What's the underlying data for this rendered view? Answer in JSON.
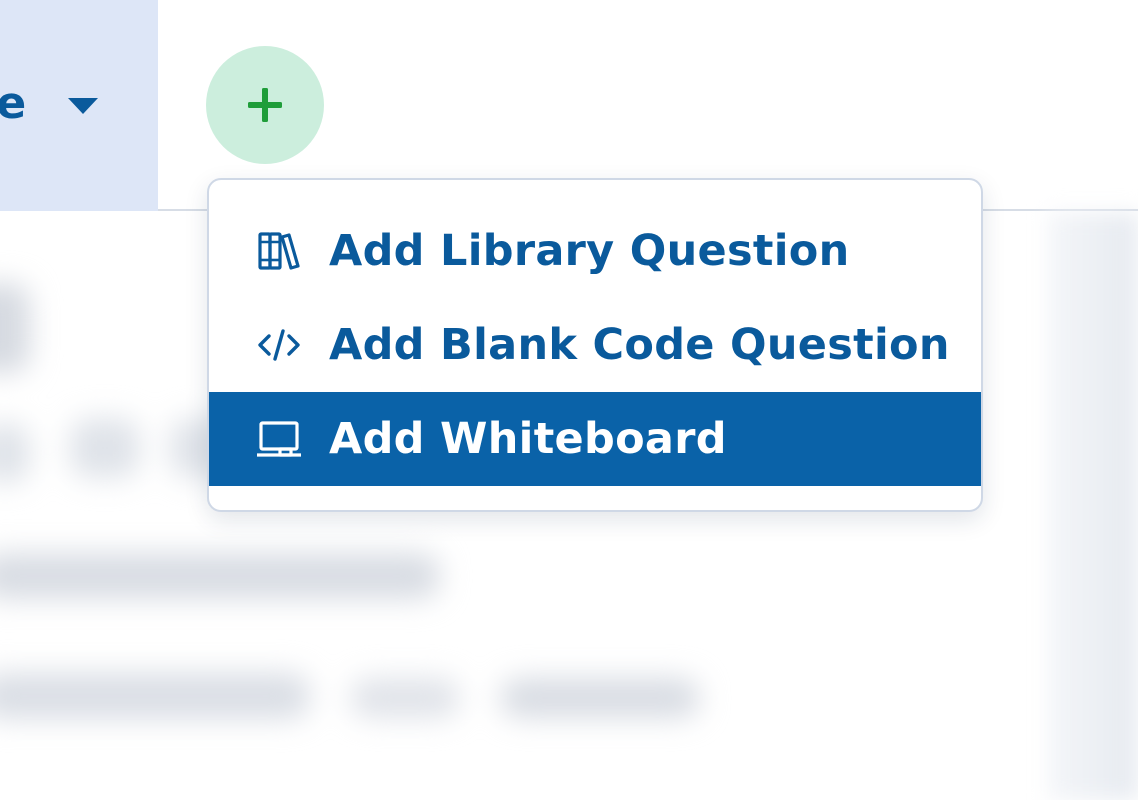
{
  "header": {
    "tab_label_partial": "ne",
    "add_button_icon": "plus-icon",
    "accent_color": "#0a5a9c",
    "add_button_color": "#1f9d3a"
  },
  "menu": {
    "items": [
      {
        "label": "Add Library Question",
        "icon": "library-books-icon",
        "selected": false
      },
      {
        "label": "Add Blank Code Question",
        "icon": "code-icon",
        "selected": false
      },
      {
        "label": "Add Whiteboard",
        "icon": "whiteboard-icon",
        "selected": true
      }
    ],
    "highlight_color": "#0a62a8"
  }
}
